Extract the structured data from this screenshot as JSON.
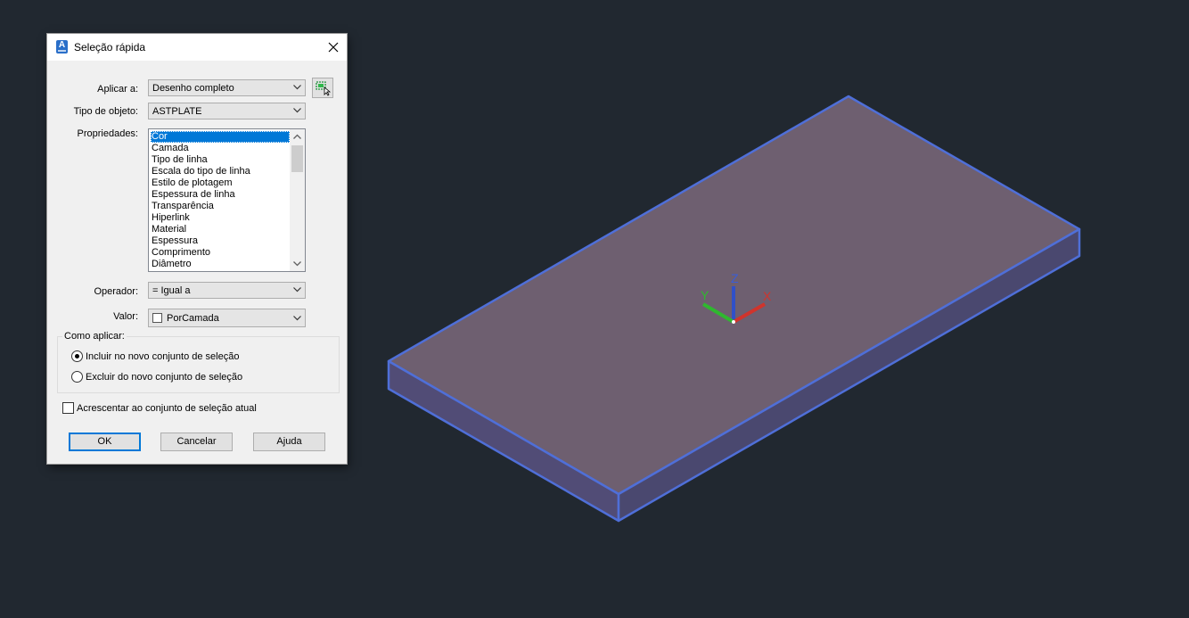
{
  "dialog": {
    "title": "Seleção rápida",
    "fields": {
      "apply_to": {
        "label": "Aplicar a:",
        "value": "Desenho completo"
      },
      "object_type": {
        "label": "Tipo de objeto:",
        "value": "ASTPLATE"
      },
      "properties": {
        "label": "Propriedades:",
        "items": [
          "Cor",
          "Camada",
          "Tipo de linha",
          "Escala do tipo de linha",
          "Estilo de plotagem",
          "Espessura de linha",
          "Transparência",
          "Hiperlink",
          "Material",
          "Espessura",
          "Comprimento",
          "Diâmetro"
        ],
        "selected": "Cor"
      },
      "operator": {
        "label": "Operador:",
        "value": "= Igual a"
      },
      "value": {
        "label": "Valor:",
        "value": "PorCamada"
      }
    },
    "how_to_apply": {
      "title": "Como aplicar:",
      "include": "Incluir no novo conjunto de seleção",
      "exclude": "Excluir do novo conjunto de seleção",
      "selected": "include"
    },
    "append": {
      "label": "Acrescentar ao conjunto de seleção atual",
      "checked": false
    },
    "buttons": {
      "ok": "OK",
      "cancel": "Cancelar",
      "help": "Ajuda"
    }
  },
  "viewport": {
    "background": "#212830",
    "ucs": {
      "x": "X",
      "y": "Y",
      "z": "Z"
    },
    "colors": {
      "edge": "#4f6fd8",
      "top_face": "#6e5f70",
      "side_face": "#55507a",
      "x_axis": "#d0342c",
      "y_axis": "#2fb82f",
      "z_axis": "#3050c8"
    }
  },
  "icons": [
    "app-icon",
    "close-icon",
    "chevron-down-icon",
    "select-objects-icon",
    "scroll-up-icon",
    "scroll-down-icon"
  ]
}
